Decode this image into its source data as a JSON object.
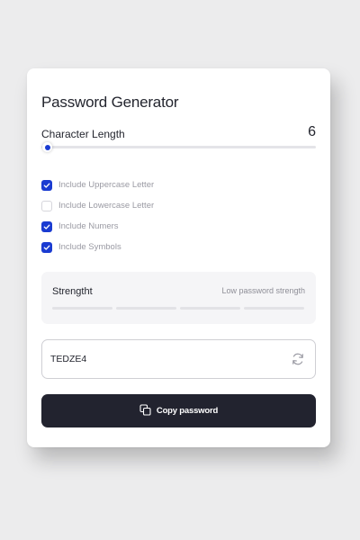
{
  "app": {
    "title": "Password Generator"
  },
  "length": {
    "label": "Character Length",
    "value": "6",
    "slider_fraction": 0.02
  },
  "options": [
    {
      "label": "Include Uppercase Letter",
      "checked": true
    },
    {
      "label": "Include Lowercase Letter",
      "checked": false
    },
    {
      "label": "Include Numers",
      "checked": true
    },
    {
      "label": "Include Symbols",
      "checked": true
    }
  ],
  "strength": {
    "label": "Strengtht",
    "description": "Low password strength",
    "filled_bars": 0,
    "total_bars": 4
  },
  "password": {
    "value": "TEDZE4"
  },
  "copy_button": {
    "label": "Copy password"
  },
  "icons": {
    "checkbox": "check-icon",
    "refresh": "refresh-icon",
    "copy": "copy-icon"
  },
  "colors": {
    "accent": "#1a3bd1",
    "button_bg": "#22232f",
    "background": "#ececed",
    "card": "#ffffff"
  }
}
